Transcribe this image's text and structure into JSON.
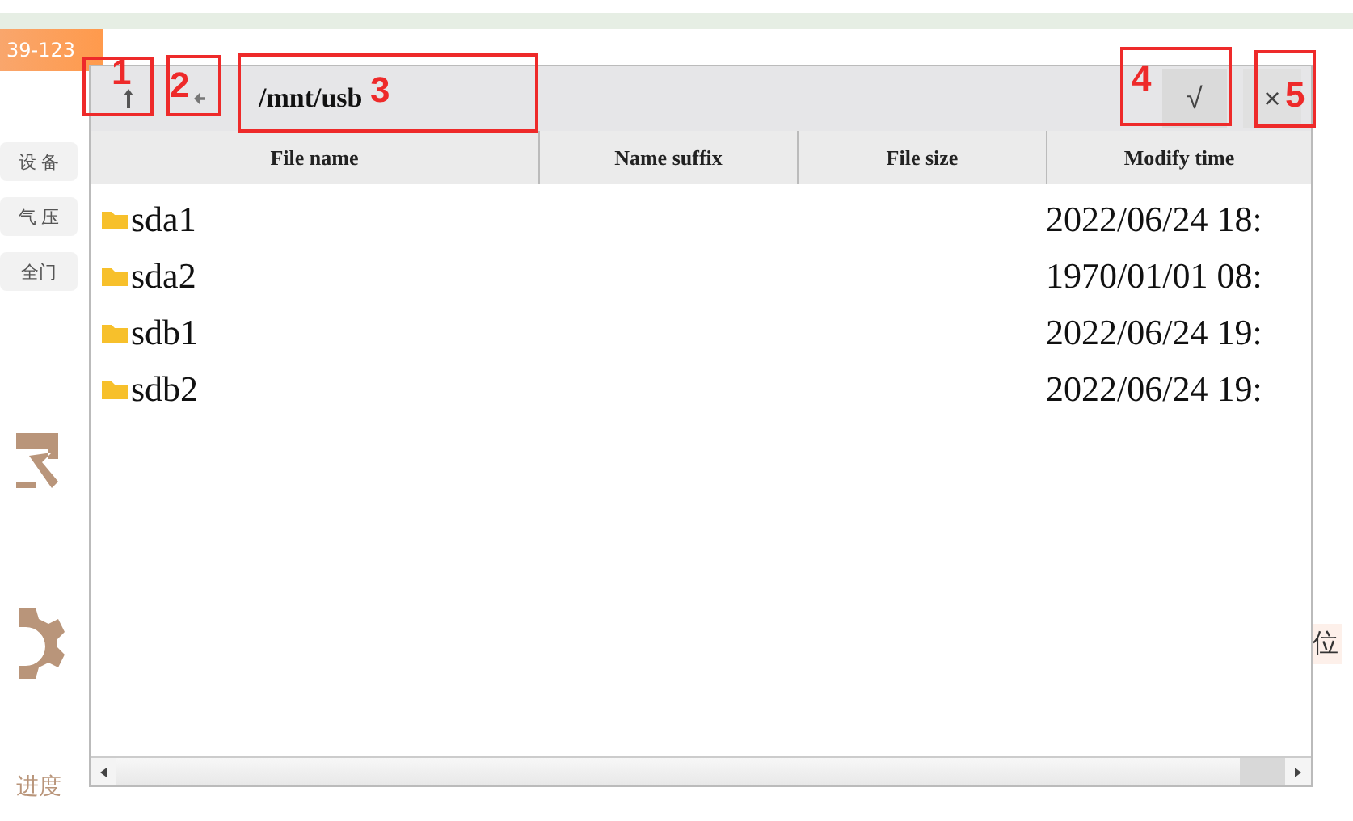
{
  "background": {
    "badge": "39-123",
    "side_buttons": [
      "设 备",
      "气 压",
      "全门"
    ],
    "side_label": "位",
    "progress": {
      "label": "进度"
    }
  },
  "dialog": {
    "path": "/mnt/usb",
    "confirm": "√",
    "close": "×",
    "columns": [
      "File name",
      "Name suffix",
      "File size",
      "Modify time"
    ],
    "rows": [
      {
        "name": "sda1",
        "time": "2022/06/24 18:"
      },
      {
        "name": "sda2",
        "time": "1970/01/01 08:"
      },
      {
        "name": "sdb1",
        "time": "2022/06/24 19:"
      },
      {
        "name": "sdb2",
        "time": "2022/06/24 19:"
      }
    ]
  },
  "annotations": [
    "1",
    "2",
    "3",
    "4",
    "5"
  ]
}
